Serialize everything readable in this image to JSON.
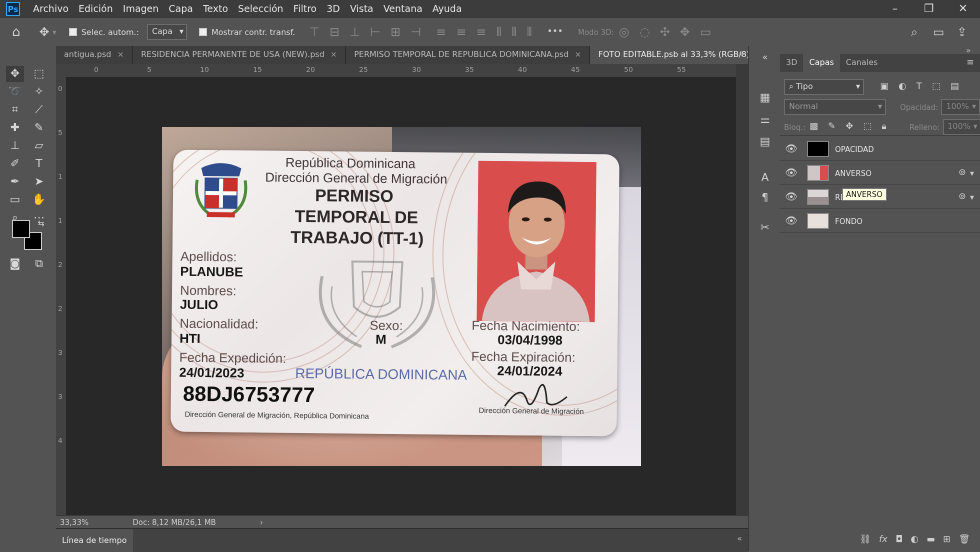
{
  "app": {
    "logo": "Ps"
  },
  "menu": [
    "Archivo",
    "Edición",
    "Imagen",
    "Capa",
    "Texto",
    "Selección",
    "Filtro",
    "3D",
    "Vista",
    "Ventana",
    "Ayuda"
  ],
  "window_controls": {
    "minimize": "–",
    "restore": "❐",
    "close": "✕"
  },
  "options": {
    "auto_select_label": "Selec. autom.:",
    "auto_select_value": "Capa",
    "show_transform_label": "Mostrar contr. transf.",
    "more": "•••",
    "mode_3d_label": "Modo 3D:"
  },
  "tabs": [
    {
      "label": "antigua.psd",
      "active": false
    },
    {
      "label": "RESIDENCIA PERMANENTE DE USA (NEW).psd",
      "active": false
    },
    {
      "label": "PERMISO TEMPORAL DE REPUBLICA DOMINICANA.psd",
      "active": false
    },
    {
      "label": "FOTO EDITABLE.psb al 33,3% (RGB/8)",
      "active": true
    }
  ],
  "tab_close": "×",
  "ruler_top_ticks": [
    "0",
    "5",
    "10",
    "15",
    "20",
    "25",
    "30",
    "35",
    "40",
    "45",
    "50",
    "55"
  ],
  "ruler_left_ticks": [
    "0",
    "5",
    "1",
    "1",
    "2",
    "2",
    "3",
    "3",
    "4"
  ],
  "card": {
    "line1": "República Dominicana",
    "line2": "Dirección General de Migración",
    "title1": "PERMISO",
    "title2": "TEMPORAL DE",
    "title3": "TRABAJO (TT-1)",
    "apellidos_label": "Apellidos:",
    "apellidos_value": "PLANUBE",
    "nombres_label": "Nombres:",
    "nombres_value": "JULIO",
    "nacionalidad_label": "Nacionalidad:",
    "nacionalidad_value": "HTI",
    "sexo_label": "Sexo:",
    "sexo_value": "M",
    "fecha_nac_label": "Fecha Nacimiento:",
    "fecha_nac_value": "03/04/1998",
    "fecha_exp_label": "Fecha Expedición:",
    "fecha_exp_value": "24/01/2023",
    "fecha_expira_label": "Fecha Expiración:",
    "fecha_expira_value": "24/01/2024",
    "watermark": "REPÚBLICA DOMINICANA",
    "id_number": "88DJ6753777",
    "footer": "Dirección General de Migración, República Dominicana",
    "sign_caption": "Dirección General de Migración"
  },
  "panel": {
    "tabs": [
      {
        "label": "3D",
        "active": false
      },
      {
        "label": "Capas",
        "active": true
      },
      {
        "label": "Canales",
        "active": false
      }
    ],
    "filter_value": "Tipo",
    "blend_mode": "Normal",
    "opacity_label": "Opacidad:",
    "opacity_value": "100%",
    "lock_label": "Bloq.:",
    "fill_label": "Relleno:",
    "fill_value": "100%",
    "layers": [
      {
        "name": "OPACIDAD",
        "thumb": "#000000"
      },
      {
        "name": "ANVERSO",
        "thumb": "#cfc7c7"
      },
      {
        "name": "REVERSO",
        "thumb": "#dcd6d6"
      },
      {
        "name": "FONDO",
        "thumb": "#e8e0dc"
      }
    ],
    "tooltip": "ANVERSO",
    "menu": "≡",
    "bottom_icons": [
      "fx"
    ]
  },
  "status": {
    "zoom": "33,33%",
    "doc": "Doc: 8,12 MB/26,1 MB",
    "arrow": "›"
  },
  "timeline": {
    "label": "Línea de tiempo"
  },
  "colors": {
    "ui_bg": "#535353",
    "menu_bg": "#3c3c3c",
    "canvas_bg": "#282828",
    "accent": "#31a8ff",
    "photo_red": "#d94d4d"
  }
}
